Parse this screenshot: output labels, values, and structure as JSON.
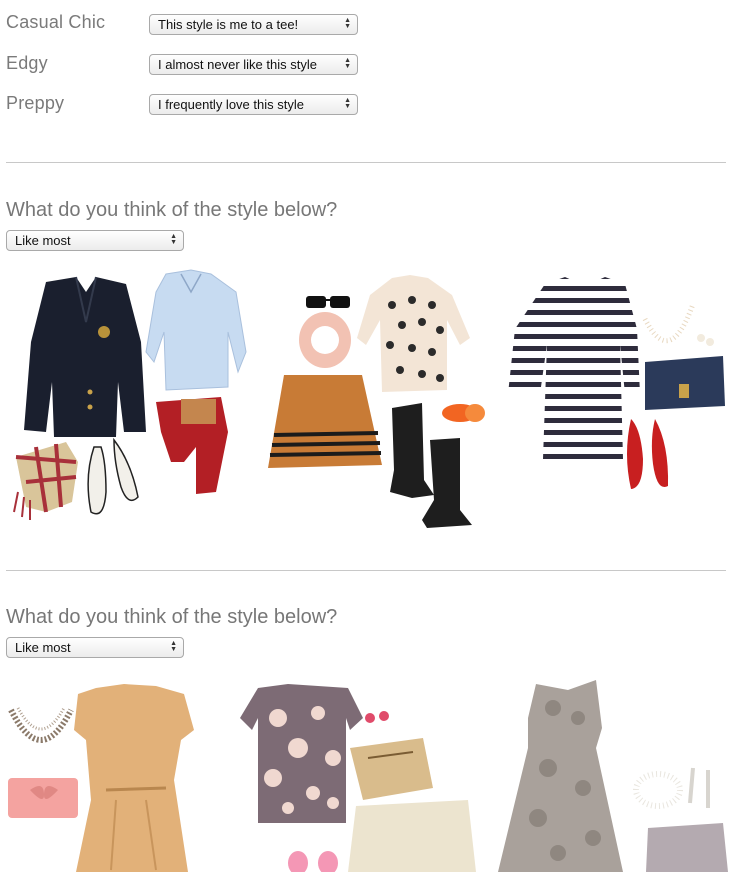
{
  "ratings": [
    {
      "label": "Casual Chic",
      "value": "This style is me to a tee!"
    },
    {
      "label": "Edgy",
      "value": "I almost never like this style"
    },
    {
      "label": "Preppy",
      "value": "I frequently love this style"
    }
  ],
  "sections": [
    {
      "question": "What do you think of the style below?",
      "select_value": "Like most",
      "outfits": [
        "outfit-preppy",
        "outfit-casual-chic",
        "outfit-striped"
      ]
    },
    {
      "question": "What do you think of the style below?",
      "select_value": "Like most",
      "outfits": [
        "outfit-draped-dress",
        "outfit-floral",
        "outfit-lace-dress"
      ]
    }
  ],
  "colors": {
    "label": "#7a7a7a",
    "divider": "#c8c8c8"
  }
}
